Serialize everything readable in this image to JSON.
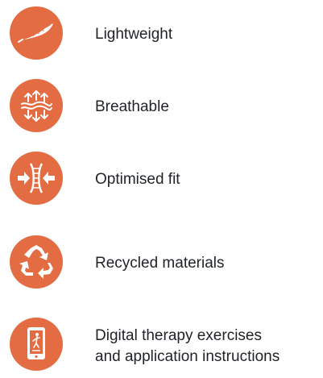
{
  "features": [
    {
      "icon": "feather-icon",
      "label": "Lightweight"
    },
    {
      "icon": "breathable-arrows-icon",
      "label": "Breathable"
    },
    {
      "icon": "optimised-fit-icon",
      "label": "Optimised fit"
    },
    {
      "icon": "recycle-icon",
      "label": "Recycled materials"
    },
    {
      "icon": "smartphone-exercise-icon",
      "label_line1": "Digital therapy exercises",
      "label_line2": "and application instructions"
    }
  ],
  "colors": {
    "accent": "#e46c43",
    "text": "#1f2226",
    "background": "#ffffff"
  }
}
